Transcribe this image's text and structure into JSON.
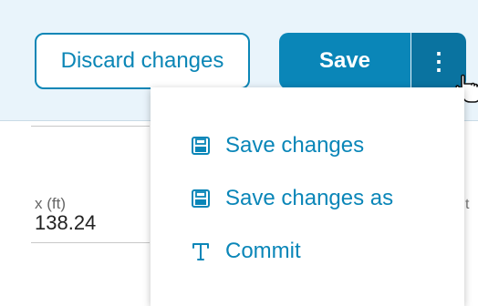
{
  "toolbar": {
    "discard_label": "Discard changes",
    "save_label": "Save",
    "more_label": "⋮",
    "accent_color": "#0a86b8"
  },
  "field": {
    "label": "x (ft)",
    "value": "138.24",
    "right_partial": "t"
  },
  "menu": {
    "items": [
      {
        "label": "Save changes",
        "icon": "floppy-disk-icon"
      },
      {
        "label": "Save changes as",
        "icon": "floppy-disk-icon"
      },
      {
        "label": "Commit",
        "icon": "commit-icon"
      }
    ]
  }
}
